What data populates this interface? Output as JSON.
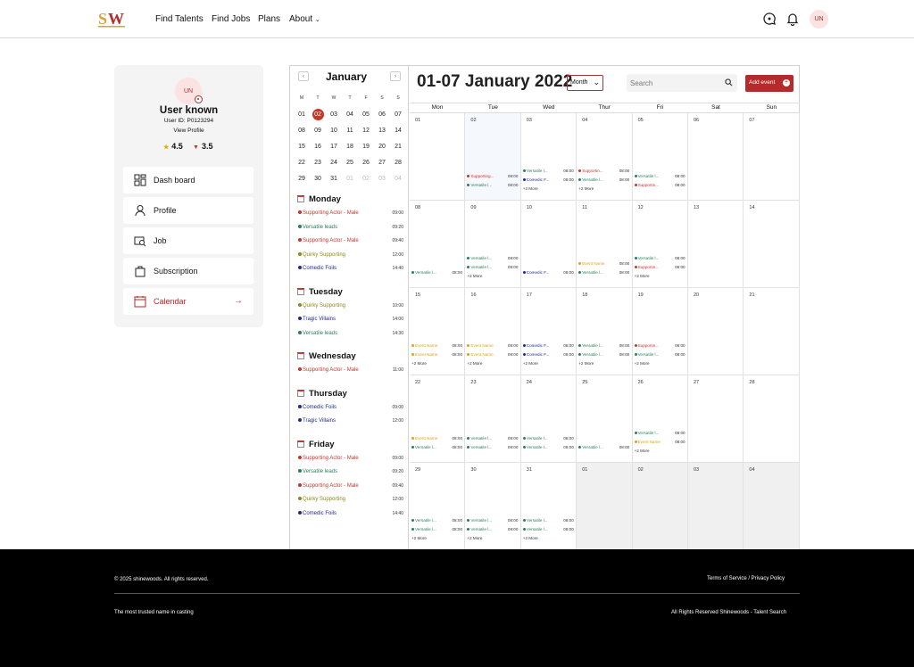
{
  "header": {
    "logo_text": "SW",
    "nav": [
      "Find Talents",
      "Find Jobs",
      "Plans",
      "About"
    ],
    "avatar": "UN"
  },
  "profile": {
    "avatar": "UN",
    "name": "User known",
    "user_id": "User ID: P0123294",
    "view_profile": "View Profile",
    "rating_star": "4.5",
    "rating_medal": "3.5"
  },
  "menu": [
    {
      "label": "Dash board",
      "icon": "dashboard-icon"
    },
    {
      "label": "Profile",
      "icon": "user-icon"
    },
    {
      "label": "Job",
      "icon": "job-search-icon"
    },
    {
      "label": "Subscription",
      "icon": "subscription-icon"
    },
    {
      "label": "Calendar",
      "icon": "calendar-icon"
    }
  ],
  "colors": {
    "brand": "#b52a2a",
    "supporting": "#c0392b",
    "versatile": "#2e7d5b",
    "quirky": "#8a8a1a",
    "comedic": "#1f2a8a",
    "tragic": "#1f2a8a",
    "event": "#e0a020"
  },
  "mini_calendar": {
    "title": "January",
    "prev": "‹",
    "next": "›",
    "dow": [
      "M",
      "T",
      "W",
      "T",
      "F",
      "S",
      "S"
    ],
    "days": [
      "01",
      "02",
      "03",
      "04",
      "05",
      "06",
      "07",
      "08",
      "09",
      "10",
      "11",
      "12",
      "13",
      "14",
      "15",
      "16",
      "17",
      "18",
      "19",
      "20",
      "21",
      "22",
      "23",
      "24",
      "25",
      "26",
      "27",
      "28",
      "29",
      "30",
      "31",
      "01",
      "02",
      "03",
      "04"
    ],
    "selected": 1,
    "other_from": 31
  },
  "agenda": [
    {
      "day": "Monday",
      "items": [
        [
          "Supporting Actor - Male",
          "09:00",
          "supporting"
        ],
        [
          "Versatile leads",
          "09:20",
          "versatile"
        ],
        [
          "Supporting Actor - Male",
          "09:40",
          "supporting"
        ],
        [
          "Quirky Supporting",
          "12:00",
          "quirky"
        ],
        [
          "Comedic Foils",
          "14:40",
          "comedic"
        ]
      ]
    },
    {
      "day": "Tuesday",
      "items": [
        [
          "Quirky Supporting",
          "10:00",
          "quirky"
        ],
        [
          "Tragic Villains",
          "14:00",
          "tragic"
        ],
        [
          "Versatile leads",
          "14:30",
          "versatile"
        ]
      ]
    },
    {
      "day": "Wednesday",
      "items": [
        [
          "Supporting Actor - Male",
          "11:00",
          "supporting"
        ]
      ]
    },
    {
      "day": "Thursday",
      "items": [
        [
          "Comedic Foils",
          "09:00",
          "comedic"
        ],
        [
          "Tragic Villains",
          "12:00",
          "tragic"
        ]
      ]
    },
    {
      "day": "Friday",
      "items": [
        [
          "Supporting Actor - Male",
          "09:00",
          "supporting"
        ],
        [
          "Versatile leads",
          "09:20",
          "versatile"
        ],
        [
          "Supporting Actor - Male",
          "09:40",
          "supporting"
        ],
        [
          "Quirky Supporting",
          "12:00",
          "quirky"
        ],
        [
          "Comedic Foils",
          "14:40",
          "comedic"
        ]
      ]
    }
  ],
  "toolbar": {
    "range_title": "01-07 January 2022",
    "view": "Month",
    "search_placeholder": "Search",
    "add_event": "Add event"
  },
  "week_days": [
    "Mon",
    "Tue",
    "Wed",
    "Thur",
    "Fri",
    "Sat",
    "Sun"
  ],
  "month_grid": {
    "cells": [
      {
        "n": "01",
        "ev": []
      },
      {
        "n": "02",
        "hl": 1,
        "ev": [
          [
            "Supporting...",
            "08:00",
            "supporting"
          ],
          [
            "Versatile l...",
            "08:00",
            "versatile"
          ]
        ]
      },
      {
        "n": "03",
        "ev": [
          [
            "Versatile l...",
            "08:00",
            "versatile"
          ],
          [
            "Comedic F...",
            "08:00",
            "comedic"
          ]
        ],
        "more": 1
      },
      {
        "n": "04",
        "ev": [
          [
            "Supportin...",
            "08:00",
            "supporting"
          ],
          [
            "Versatile l...",
            "08:00",
            "versatile"
          ]
        ],
        "more": 1
      },
      {
        "n": "05",
        "ev": [
          [
            "Versatile l...",
            "08:00",
            "versatile"
          ],
          [
            "Supportin...",
            "08:00",
            "supporting"
          ]
        ]
      },
      {
        "n": "06",
        "ev": []
      },
      {
        "n": "07",
        "ev": []
      },
      {
        "n": "08",
        "ev": [
          [
            "Versatile l...",
            "08:00",
            "versatile"
          ]
        ]
      },
      {
        "n": "09",
        "ev": [
          [
            "Versatile l...",
            "08:00",
            "versatile"
          ],
          [
            "Versatile l...",
            "08:00",
            "versatile"
          ]
        ],
        "more": 1
      },
      {
        "n": "10",
        "ev": [
          [
            "Comedic F...",
            "08:00",
            "comedic"
          ]
        ]
      },
      {
        "n": "11",
        "ev": [
          [
            "Event Name",
            "08:00",
            "event"
          ],
          [
            "Versatile l...",
            "08:00",
            "versatile"
          ]
        ]
      },
      {
        "n": "12",
        "ev": [
          [
            "Versatile l...",
            "08:00",
            "versatile"
          ],
          [
            "Supportin...",
            "08:00",
            "supporting"
          ]
        ],
        "more": 1
      },
      {
        "n": "13",
        "ev": []
      },
      {
        "n": "14",
        "ev": []
      },
      {
        "n": "15",
        "ev": [
          [
            "Event Name",
            "08:00",
            "event"
          ],
          [
            "Event Name",
            "08:00",
            "event"
          ]
        ],
        "more": 1
      },
      {
        "n": "16",
        "ev": [
          [
            "Event Name",
            "08:00",
            "event"
          ],
          [
            "Event Name",
            "08:00",
            "event"
          ]
        ],
        "more": 1
      },
      {
        "n": "17",
        "ev": [
          [
            "Comedic F...",
            "08:00",
            "comedic"
          ],
          [
            "Comedic F...",
            "08:00",
            "comedic"
          ]
        ],
        "more": 1
      },
      {
        "n": "18",
        "ev": [
          [
            "Versatile l...",
            "08:00",
            "versatile"
          ],
          [
            "Versatile l...",
            "08:00",
            "versatile"
          ]
        ],
        "more": 1
      },
      {
        "n": "19",
        "ev": [
          [
            "Supportin...",
            "08:00",
            "supporting"
          ],
          [
            "Versatile l...",
            "08:00",
            "versatile"
          ]
        ],
        "more": 1
      },
      {
        "n": "20",
        "ev": []
      },
      {
        "n": "21",
        "ev": []
      },
      {
        "n": "22",
        "ev": [
          [
            "Event Name",
            "08:00",
            "event"
          ],
          [
            "Versatile l...",
            "08:00",
            "versatile"
          ]
        ]
      },
      {
        "n": "23",
        "ev": [
          [
            "Versatile l...",
            "08:00",
            "versatile"
          ],
          [
            "Versatile l...",
            "08:00",
            "versatile"
          ]
        ]
      },
      {
        "n": "24",
        "ev": [
          [
            "Versatile l...",
            "08:00",
            "versatile"
          ],
          [
            "Versatile l...",
            "08:00",
            "versatile"
          ]
        ]
      },
      {
        "n": "25",
        "ev": [
          [
            "Versatile l...",
            "08:00",
            "versatile"
          ]
        ]
      },
      {
        "n": "26",
        "ev": [
          [
            "Versatile l...",
            "08:00",
            "versatile"
          ],
          [
            "Event Name",
            "08:00",
            "event"
          ]
        ],
        "more": 1
      },
      {
        "n": "27",
        "ev": []
      },
      {
        "n": "28",
        "ev": []
      },
      {
        "n": "29",
        "ev": [
          [
            "Versatile l...",
            "08:00",
            "versatile"
          ],
          [
            "Versatile l...",
            "08:00",
            "versatile"
          ]
        ],
        "more": 1
      },
      {
        "n": "30",
        "ev": [
          [
            "Versatile l...",
            "08:00",
            "versatile"
          ],
          [
            "Versatile l...",
            "08:00",
            "versatile"
          ]
        ],
        "more": 1
      },
      {
        "n": "31",
        "ev": [
          [
            "Versatile l...",
            "08:00",
            "versatile"
          ],
          [
            "Versatile l...",
            "08:00",
            "versatile"
          ]
        ],
        "more": 1
      },
      {
        "n": "01",
        "grey": 1,
        "ev": []
      },
      {
        "n": "02",
        "grey": 1,
        "ev": []
      },
      {
        "n": "03",
        "grey": 1,
        "ev": []
      },
      {
        "n": "04",
        "grey": 1,
        "ev": []
      }
    ],
    "more_label": "+2 More"
  },
  "footer": {
    "copyright": "© 2025 shinewoods. All rights reserved.",
    "links": "Terms of Service / Privacy Policy",
    "tagline": "The most trusted name in casting",
    "rights": "All Rights Reserved Shinewoods - Talent Search"
  }
}
